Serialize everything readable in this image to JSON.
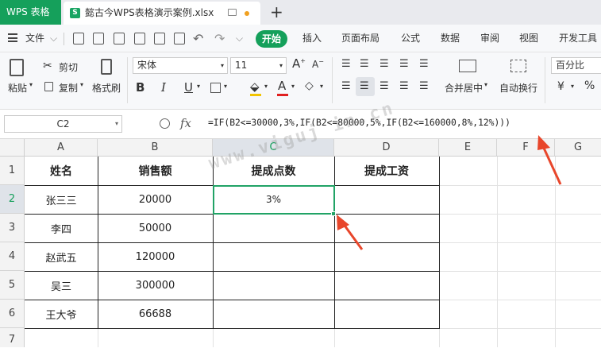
{
  "titlebar": {
    "app_tab": "WPS 表格",
    "doc_tab": "懿古今WPS表格演示案例.xlsx",
    "new_tab": "+"
  },
  "menubar": {
    "file": "文件",
    "tabs": [
      "开始",
      "插入",
      "页面布局",
      "公式",
      "数据",
      "审阅",
      "视图",
      "开发工具"
    ],
    "active_tab": "开始"
  },
  "ribbon": {
    "paste": "粘贴",
    "cut": "剪切",
    "copy": "复制",
    "format_painter": "格式刷",
    "font_name": "宋体",
    "font_size": "11",
    "bold": "B",
    "italic": "I",
    "underline": "U",
    "merge_center": "合并居中",
    "wrap_text": "自动换行",
    "number_format": "百分比",
    "currency": "¥",
    "percent": "%"
  },
  "formula_bar": {
    "name_box": "C2",
    "fx": "fx",
    "formula": "=IF(B2<=30000,3%,IF(B2<=80000,5%,IF(B2<=160000,8%,12%)))"
  },
  "sheet": {
    "columns": [
      "A",
      "B",
      "C",
      "D",
      "E",
      "F",
      "G"
    ],
    "rows": [
      "1",
      "2",
      "3",
      "4",
      "5",
      "6",
      "7"
    ],
    "headers": [
      "姓名",
      "销售额",
      "提成点数",
      "提成工资"
    ],
    "data": [
      {
        "name": "张三三",
        "sales": "20000",
        "rate": "3%",
        "pay": ""
      },
      {
        "name": "李四",
        "sales": "50000",
        "rate": "",
        "pay": ""
      },
      {
        "name": "赵武五",
        "sales": "120000",
        "rate": "",
        "pay": ""
      },
      {
        "name": "吴三",
        "sales": "300000",
        "rate": "",
        "pay": ""
      },
      {
        "name": "王大爷",
        "sales": "66688",
        "rate": "",
        "pay": ""
      }
    ],
    "active_cell": "C2"
  },
  "watermark": "www.viguj in.cn",
  "colors": {
    "accent": "#15a05b",
    "arrow": "#e8462b",
    "selection": "#21a366"
  }
}
